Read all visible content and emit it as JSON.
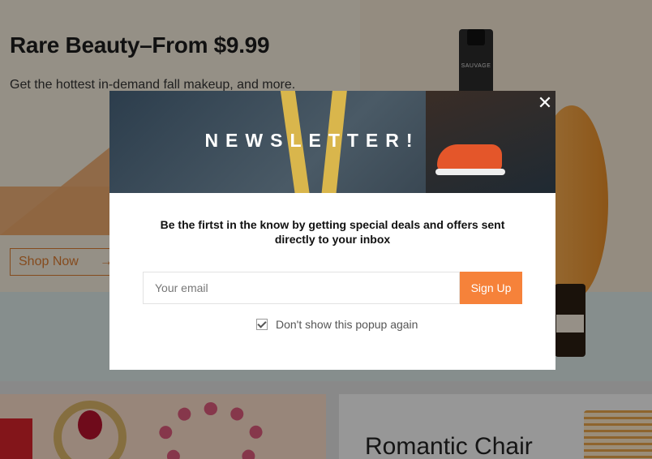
{
  "hero": {
    "title": "Rare Beauty–From $9.99",
    "subtitle": "Get the hottest in-demand fall makeup, and more.",
    "shop_now": "Shop Now",
    "bottle_label": "SAUVAGE"
  },
  "tiles": {
    "right_title": "Romantic Chair"
  },
  "modal": {
    "banner_title": "NEWSLETTER!",
    "lead": "Be the firtst in the know by getting special deals and offers sent directly to your inbox",
    "email_placeholder": "Your email",
    "signup_label": "Sign Up",
    "dont_show_label": "Don't show this popup again",
    "dont_show_checked": true
  },
  "colors": {
    "accent": "#f6823a",
    "overlay": "rgba(0,0,0,0.38)"
  },
  "icons": {
    "close": "close-icon",
    "arrow": "arrow-right-icon",
    "checkbox": "checkbox-checked-icon"
  }
}
